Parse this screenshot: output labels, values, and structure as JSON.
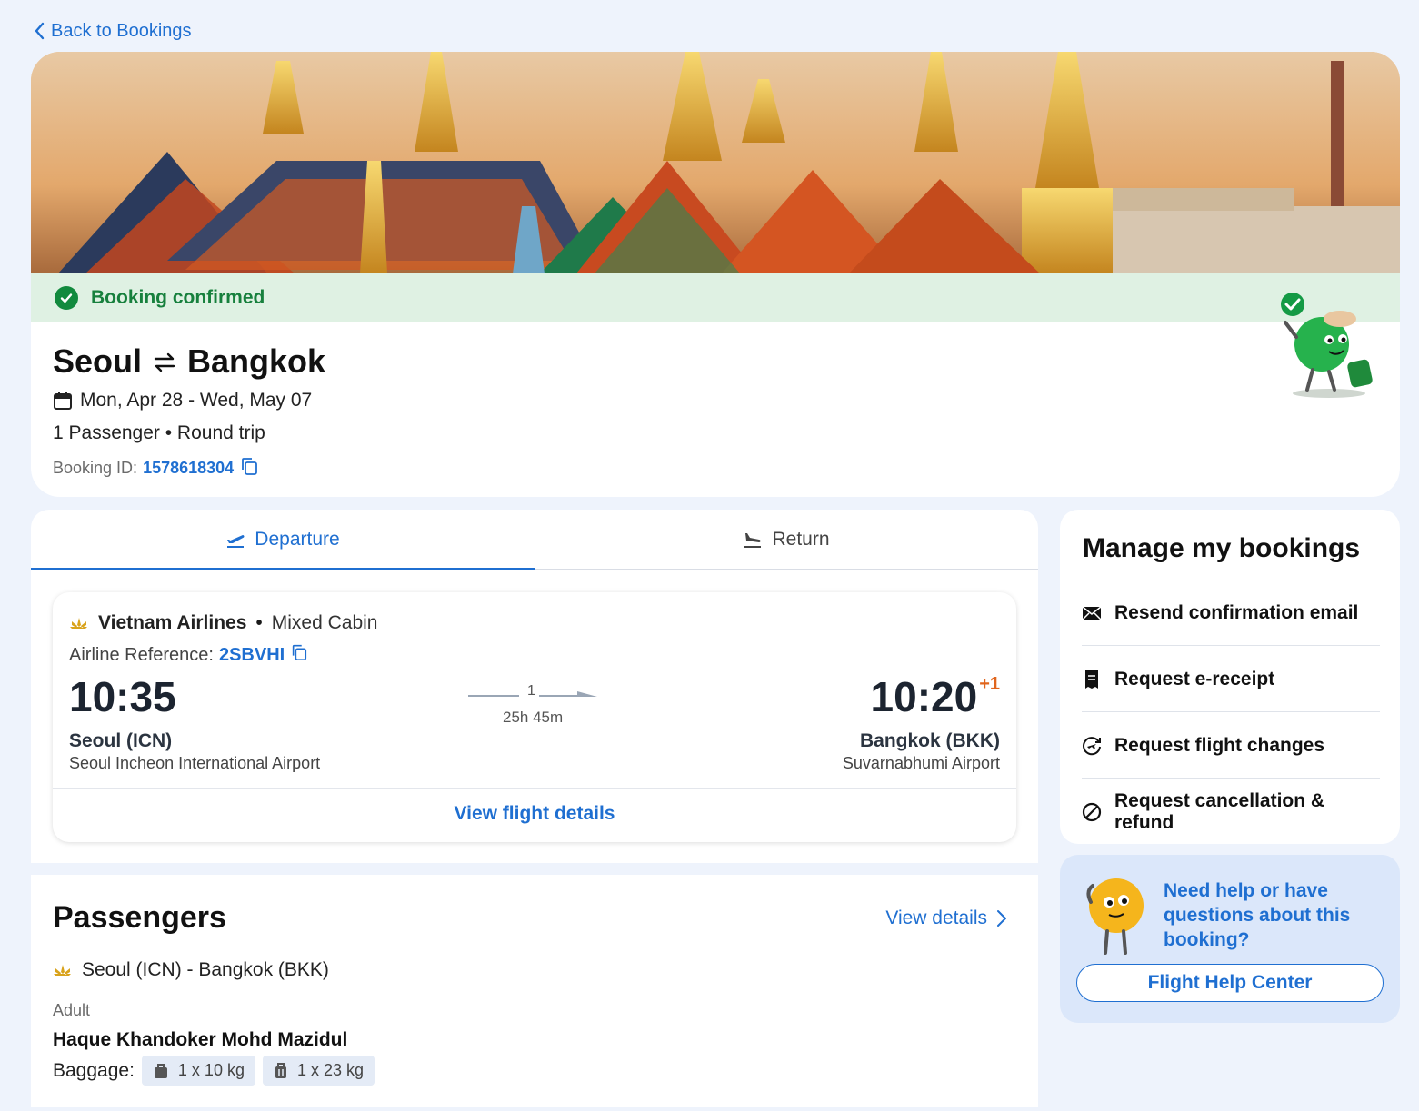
{
  "nav": {
    "back_label": "Back to Bookings"
  },
  "booking": {
    "status": "Booking confirmed",
    "origin": "Seoul",
    "destination": "Bangkok",
    "dates": "Mon, Apr 28 - Wed, May 07",
    "passengers_trip": "1 Passenger • Round trip",
    "id_label": "Booking ID:",
    "id_value": "1578618304"
  },
  "tabs": [
    {
      "label": "Departure",
      "active": true
    },
    {
      "label": "Return",
      "active": false
    }
  ],
  "flight": {
    "airline": "Vietnam Airlines",
    "separator": "•",
    "cabin": "Mixed Cabin",
    "ref_label": "Airline Reference:",
    "ref_value": "2SBVHI",
    "dep_time": "10:35",
    "dep_city": "Seoul (ICN)",
    "dep_airport": "Seoul Incheon International Airport",
    "stops": "1",
    "duration": "25h 45m",
    "arr_time": "10:20",
    "arr_day_offset": "+1",
    "arr_city": "Bangkok (BKK)",
    "arr_airport": "Suvarnabhumi Airport",
    "view_details": "View flight details"
  },
  "passengers": {
    "title": "Passengers",
    "view_details": "View details",
    "route": "Seoul (ICN) - Bangkok (BKK)",
    "type": "Adult",
    "name": "Haque Khandoker Mohd Mazidul",
    "baggage_label": "Baggage:",
    "baggage": [
      "1 x 10 kg",
      "1 x 23 kg"
    ]
  },
  "manage": {
    "title": "Manage my bookings",
    "items": [
      {
        "label": "Resend confirmation email",
        "icon": "envelope-icon"
      },
      {
        "label": "Request e-receipt",
        "icon": "receipt-icon"
      },
      {
        "label": "Request flight changes",
        "icon": "flight-change-icon"
      },
      {
        "label": "Request cancellation & refund",
        "icon": "cancel-icon"
      }
    ]
  },
  "help": {
    "text": "Need help or have questions about this booking?",
    "button": "Flight Help Center"
  },
  "colors": {
    "accent": "#1f6fd1",
    "success": "#17803d",
    "success_bg": "#dff1e3",
    "page_bg": "#eef3fc",
    "day_offset": "#e0651d"
  }
}
